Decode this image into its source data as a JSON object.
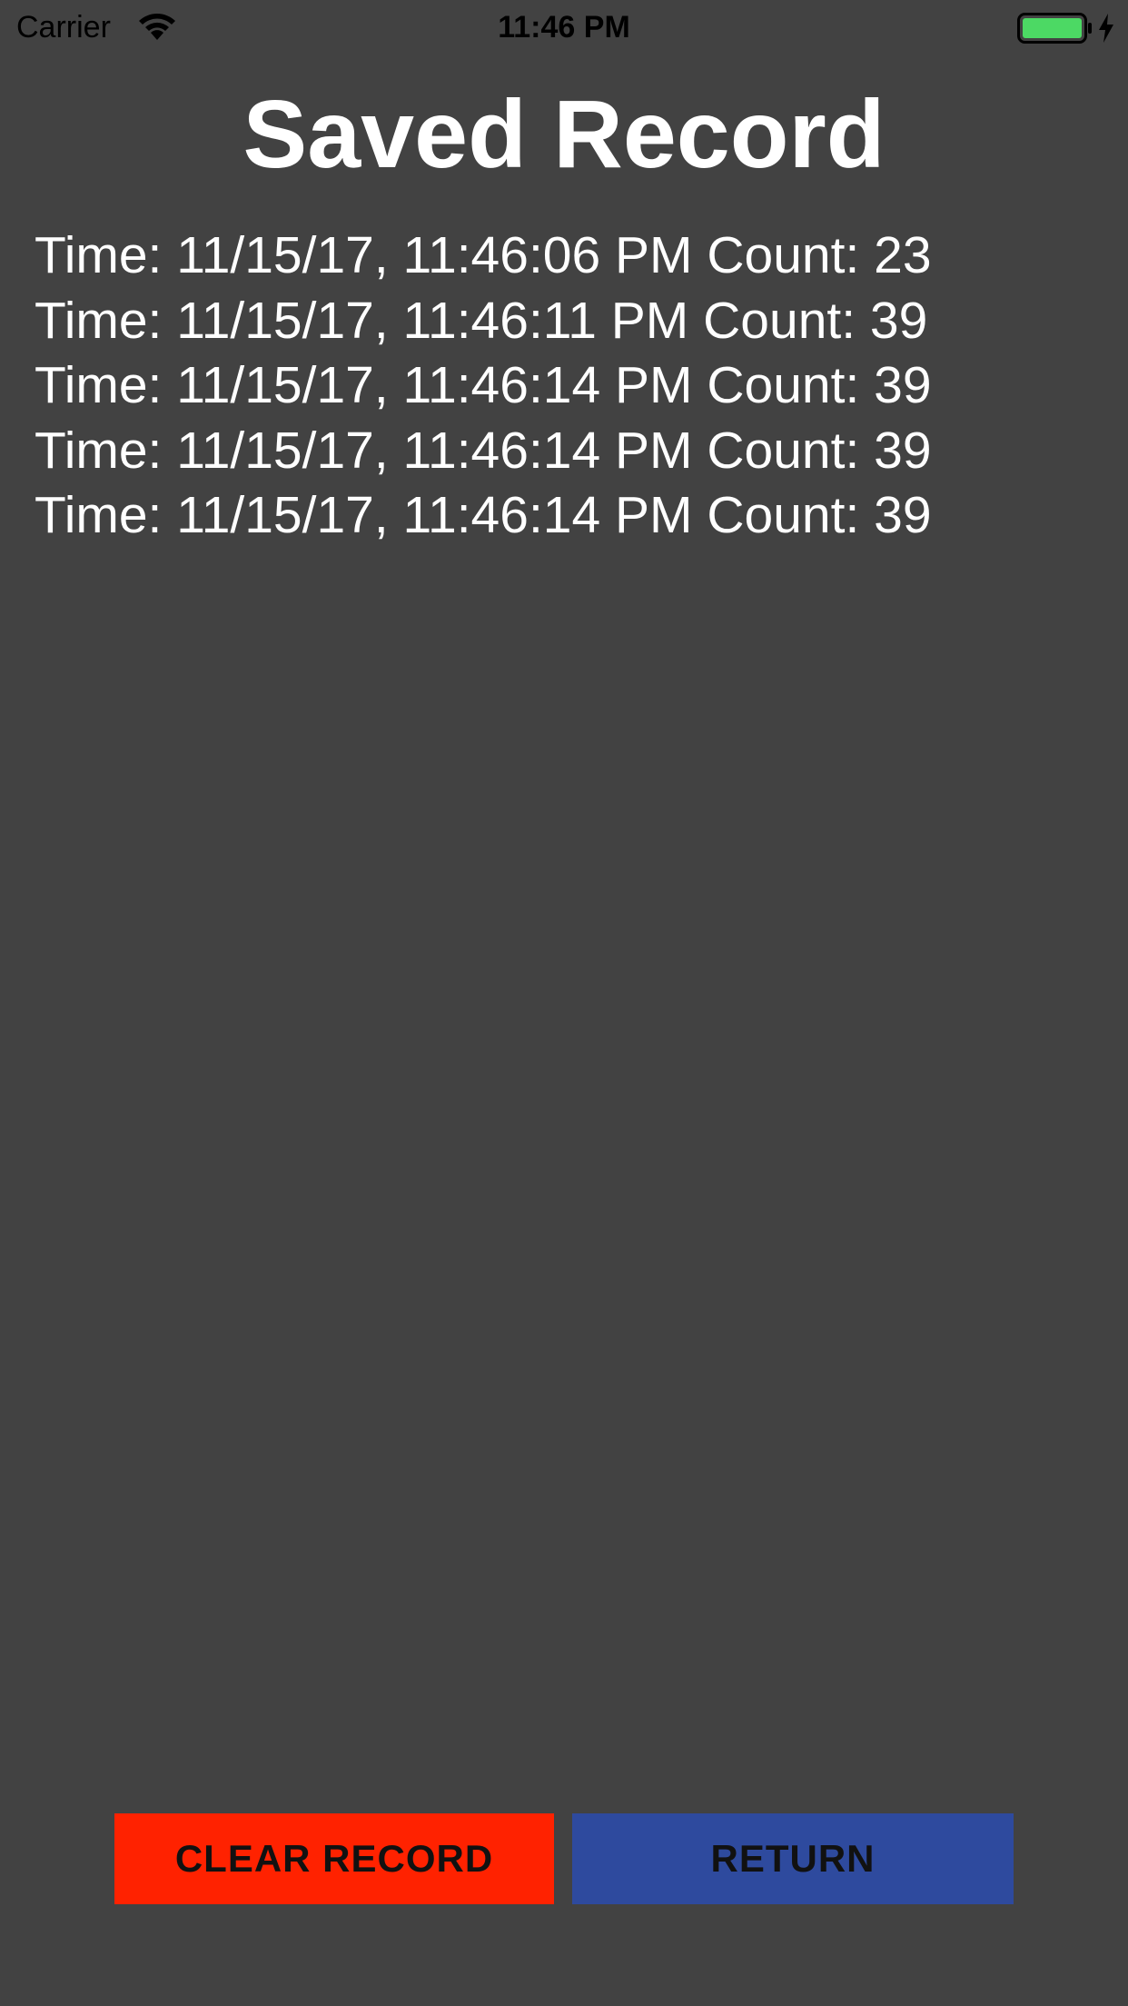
{
  "status_bar": {
    "carrier": "Carrier",
    "time": "11:46 PM",
    "icons": {
      "wifi": "wifi-icon",
      "battery": "battery-icon",
      "charging": "charging-bolt-icon"
    },
    "battery_color": "#4cd964"
  },
  "page": {
    "title": "Saved Record"
  },
  "records": [
    "Time: 11/15/17, 11:46:06 PM Count: 23",
    "Time: 11/15/17, 11:46:11 PM Count: 39",
    "Time: 11/15/17, 11:46:14 PM Count: 39",
    "Time: 11/15/17, 11:46:14 PM Count: 39",
    "Time: 11/15/17, 11:46:14 PM Count: 39"
  ],
  "buttons": {
    "clear_label": "CLEAR RECORD",
    "return_label": "RETURN",
    "clear_color": "#ff2200",
    "return_color": "#2e4a9e"
  },
  "colors": {
    "background": "#424242",
    "text": "#ffffff"
  }
}
